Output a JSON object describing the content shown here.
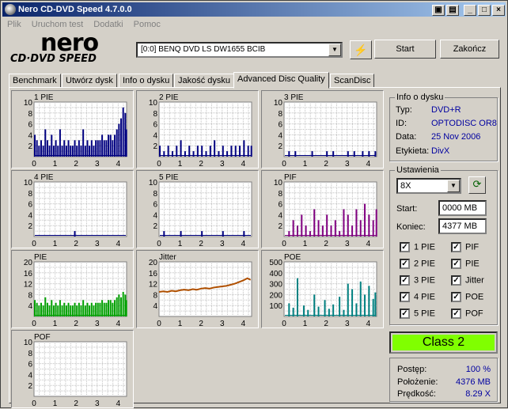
{
  "window": {
    "title": "Nero CD-DVD Speed 4.7.0.0"
  },
  "menu": [
    "Plik",
    "Uruchom test",
    "Dodatki",
    "Pomoc"
  ],
  "logo": {
    "line1": "nero",
    "line2": "CD·DVD SPEED"
  },
  "drive": {
    "selected": "[0:0]  BENQ DVD LS DW1655 BCIB"
  },
  "buttons": {
    "start": "Start",
    "exit": "Zakończ"
  },
  "tabs": [
    "Benchmark",
    "Utwórz dysk",
    "Info o dysku",
    "Jakość dysku",
    "Advanced Disc Quality",
    "ScanDisc"
  ],
  "active_tab": 4,
  "disc_info": {
    "title": "Info o dysku",
    "rows": [
      {
        "label": "Typ:",
        "value": "DVD+R"
      },
      {
        "label": "ID:",
        "value": "OPTODISC OR8"
      },
      {
        "label": "Data:",
        "value": "25 Nov 2006"
      },
      {
        "label": "Etykieta:",
        "value": "DivX"
      }
    ]
  },
  "settings": {
    "title": "Ustawienia",
    "speed": "8X",
    "start_label": "Start:",
    "start_value": "0000 MB",
    "end_label": "Koniec:",
    "end_value": "4377 MB",
    "checkboxes": [
      {
        "label": "1 PIE",
        "checked": true
      },
      {
        "label": "PIF",
        "checked": true
      },
      {
        "label": "2 PIE",
        "checked": true
      },
      {
        "label": "PIE",
        "checked": true
      },
      {
        "label": "3 PIE",
        "checked": true
      },
      {
        "label": "Jitter",
        "checked": true
      },
      {
        "label": "4 PIE",
        "checked": true
      },
      {
        "label": "POE",
        "checked": true
      },
      {
        "label": "5 PIE",
        "checked": true
      },
      {
        "label": "POF",
        "checked": true
      }
    ]
  },
  "result": {
    "class": "Class 2"
  },
  "progress": {
    "rows": [
      {
        "label": "Postęp:",
        "value": "100 %"
      },
      {
        "label": "Położenie:",
        "value": "4376 MB"
      },
      {
        "label": "Prędkość:",
        "value": "8.29 X"
      }
    ]
  },
  "colors": {
    "blue": "#000080",
    "purple": "#800080",
    "green": "#00a000",
    "brown": "#b05000",
    "teal": "#008080",
    "class_bg": "#80ff00"
  },
  "chart_data": [
    {
      "type": "bar",
      "title": "1 PIE",
      "color": "#000080",
      "ylim": [
        0,
        10
      ],
      "yticks": [
        2,
        4,
        6,
        8,
        10
      ],
      "xticks": [
        0,
        1,
        2,
        3,
        4
      ],
      "xlim": [
        0,
        4.4
      ],
      "x": [
        0.0,
        0.1,
        0.2,
        0.3,
        0.4,
        0.5,
        0.6,
        0.7,
        0.8,
        0.9,
        1.0,
        1.1,
        1.2,
        1.3,
        1.4,
        1.5,
        1.6,
        1.7,
        1.8,
        1.9,
        2.0,
        2.1,
        2.2,
        2.3,
        2.4,
        2.5,
        2.6,
        2.7,
        2.8,
        2.9,
        3.0,
        3.1,
        3.2,
        3.3,
        3.4,
        3.5,
        3.6,
        3.7,
        3.8,
        3.9,
        4.0,
        4.1,
        4.2,
        4.3,
        4.35
      ],
      "values": [
        4,
        3,
        2,
        3,
        2,
        5,
        3,
        2,
        4,
        2,
        3,
        2,
        5,
        2,
        3,
        2,
        3,
        2,
        2,
        3,
        2,
        3,
        2,
        5,
        2,
        3,
        2,
        3,
        2,
        3,
        3,
        3,
        4,
        3,
        3,
        4,
        4,
        3,
        4,
        5,
        6,
        7,
        9,
        8,
        5
      ]
    },
    {
      "type": "bar",
      "title": "2 PIE",
      "color": "#000080",
      "ylim": [
        0,
        10
      ],
      "yticks": [
        2,
        4,
        6,
        8,
        10
      ],
      "xticks": [
        0,
        1,
        2,
        3,
        4
      ],
      "xlim": [
        0,
        4.4
      ],
      "x": [
        0.0,
        0.2,
        0.4,
        0.6,
        0.8,
        1.0,
        1.2,
        1.4,
        1.6,
        1.8,
        2.0,
        2.2,
        2.4,
        2.6,
        2.8,
        3.0,
        3.2,
        3.4,
        3.6,
        3.8,
        4.0,
        4.2,
        4.35
      ],
      "values": [
        2,
        1,
        2,
        1,
        2,
        3,
        1,
        2,
        1,
        2,
        2,
        1,
        2,
        3,
        1,
        2,
        1,
        2,
        2,
        2,
        3,
        2,
        2
      ]
    },
    {
      "type": "bar",
      "title": "3 PIE",
      "color": "#000080",
      "ylim": [
        0,
        10
      ],
      "yticks": [
        2,
        4,
        6,
        8,
        10
      ],
      "xticks": [
        0,
        1,
        2,
        3,
        4
      ],
      "xlim": [
        0,
        4.4
      ],
      "x": [
        0.2,
        0.5,
        0.9,
        1.3,
        1.6,
        2.0,
        2.3,
        2.7,
        3.0,
        3.3,
        3.7,
        4.0,
        4.3
      ],
      "values": [
        1,
        1,
        0,
        1,
        0,
        1,
        1,
        0,
        1,
        1,
        1,
        1,
        1
      ]
    },
    {
      "type": "bar",
      "title": "4 PIE",
      "color": "#000080",
      "ylim": [
        0,
        10
      ],
      "yticks": [
        2,
        4,
        6,
        8,
        10
      ],
      "xticks": [
        0,
        1,
        2,
        3,
        4
      ],
      "xlim": [
        0,
        4.4
      ],
      "x": [
        0.3,
        1.1,
        1.9,
        2.6,
        3.4,
        4.1
      ],
      "values": [
        0,
        0,
        1,
        0,
        0,
        0
      ]
    },
    {
      "type": "bar",
      "title": "5 PIE",
      "color": "#000080",
      "ylim": [
        0,
        10
      ],
      "yticks": [
        2,
        4,
        6,
        8,
        10
      ],
      "xticks": [
        0,
        1,
        2,
        3,
        4
      ],
      "xlim": [
        0,
        4.4
      ],
      "x": [
        0.2,
        0.6,
        1.0,
        1.5,
        2.0,
        2.5,
        3.0,
        3.5,
        4.0
      ],
      "values": [
        1,
        0,
        1,
        0,
        1,
        0,
        1,
        0,
        1
      ]
    },
    {
      "type": "bar",
      "title": "PIF",
      "color": "#800080",
      "ylim": [
        0,
        10
      ],
      "yticks": [
        2,
        4,
        6,
        8,
        10
      ],
      "xticks": [
        0,
        1,
        2,
        3,
        4
      ],
      "xlim": [
        0,
        4.4
      ],
      "x": [
        0.2,
        0.4,
        0.6,
        0.8,
        1.0,
        1.2,
        1.4,
        1.6,
        1.8,
        2.0,
        2.2,
        2.4,
        2.6,
        2.8,
        3.0,
        3.2,
        3.4,
        3.6,
        3.8,
        4.0,
        4.2,
        4.35
      ],
      "values": [
        1,
        3,
        2,
        4,
        2,
        1,
        5,
        3,
        2,
        4,
        2,
        3,
        1,
        5,
        4,
        2,
        5,
        3,
        6,
        4,
        3,
        5
      ]
    },
    {
      "type": "bar",
      "title": "PIE",
      "color": "#00a000",
      "ylim": [
        0,
        20
      ],
      "yticks": [
        4,
        8,
        12,
        16,
        20
      ],
      "xticks": [
        0,
        1,
        2,
        3,
        4
      ],
      "xlim": [
        0,
        4.4
      ],
      "x": [
        0.0,
        0.1,
        0.2,
        0.3,
        0.4,
        0.5,
        0.6,
        0.7,
        0.8,
        0.9,
        1.0,
        1.1,
        1.2,
        1.3,
        1.4,
        1.5,
        1.6,
        1.7,
        1.8,
        1.9,
        2.0,
        2.1,
        2.2,
        2.3,
        2.4,
        2.5,
        2.6,
        2.7,
        2.8,
        2.9,
        3.0,
        3.1,
        3.2,
        3.3,
        3.4,
        3.5,
        3.6,
        3.7,
        3.8,
        3.9,
        4.0,
        4.1,
        4.2,
        4.3,
        4.35
      ],
      "values": [
        6,
        5,
        4,
        5,
        4,
        7,
        5,
        4,
        6,
        4,
        5,
        4,
        6,
        4,
        5,
        4,
        5,
        4,
        4,
        5,
        4,
        5,
        4,
        6,
        4,
        5,
        4,
        5,
        4,
        5,
        5,
        5,
        6,
        5,
        5,
        6,
        6,
        5,
        6,
        7,
        8,
        7,
        9,
        8,
        6
      ]
    },
    {
      "type": "line",
      "title": "Jitter",
      "color": "#b05000",
      "ylim": [
        0,
        20
      ],
      "yticks": [
        4,
        8,
        12,
        16,
        20
      ],
      "xticks": [
        0,
        1,
        2,
        3,
        4
      ],
      "xlim": [
        0,
        4.4
      ],
      "x": [
        0.0,
        0.2,
        0.4,
        0.6,
        0.8,
        1.0,
        1.2,
        1.4,
        1.6,
        1.8,
        2.0,
        2.2,
        2.4,
        2.6,
        2.8,
        3.0,
        3.2,
        3.4,
        3.6,
        3.8,
        4.0,
        4.2,
        4.35
      ],
      "values": [
        9.0,
        9.2,
        9.0,
        9.4,
        9.2,
        9.6,
        9.8,
        9.6,
        10.0,
        9.8,
        10.2,
        10.4,
        10.2,
        10.6,
        10.8,
        11.0,
        11.2,
        11.6,
        12.0,
        12.6,
        13.2,
        14.0,
        13.4
      ]
    },
    {
      "type": "bar",
      "title": "POE",
      "color": "#008080",
      "ylim": [
        0,
        500
      ],
      "yticks": [
        100,
        200,
        300,
        400,
        500
      ],
      "xticks": [
        0,
        1,
        2,
        3,
        4
      ],
      "xlim": [
        0,
        4.4
      ],
      "x": [
        0.2,
        0.4,
        0.6,
        0.9,
        1.1,
        1.4,
        1.6,
        1.9,
        2.1,
        2.3,
        2.6,
        2.8,
        3.0,
        3.2,
        3.4,
        3.6,
        3.8,
        4.0,
        4.2,
        4.3
      ],
      "values": [
        120,
        80,
        350,
        100,
        60,
        200,
        90,
        150,
        70,
        110,
        180,
        60,
        300,
        250,
        120,
        320,
        200,
        280,
        160,
        220
      ]
    },
    {
      "type": "bar",
      "title": "POF",
      "color": "#000080",
      "ylim": [
        0,
        10
      ],
      "yticks": [
        2,
        4,
        6,
        8,
        10
      ],
      "xticks": [
        0,
        1,
        2,
        3,
        4
      ],
      "xlim": [
        0,
        4.4
      ],
      "x": [],
      "values": []
    }
  ]
}
